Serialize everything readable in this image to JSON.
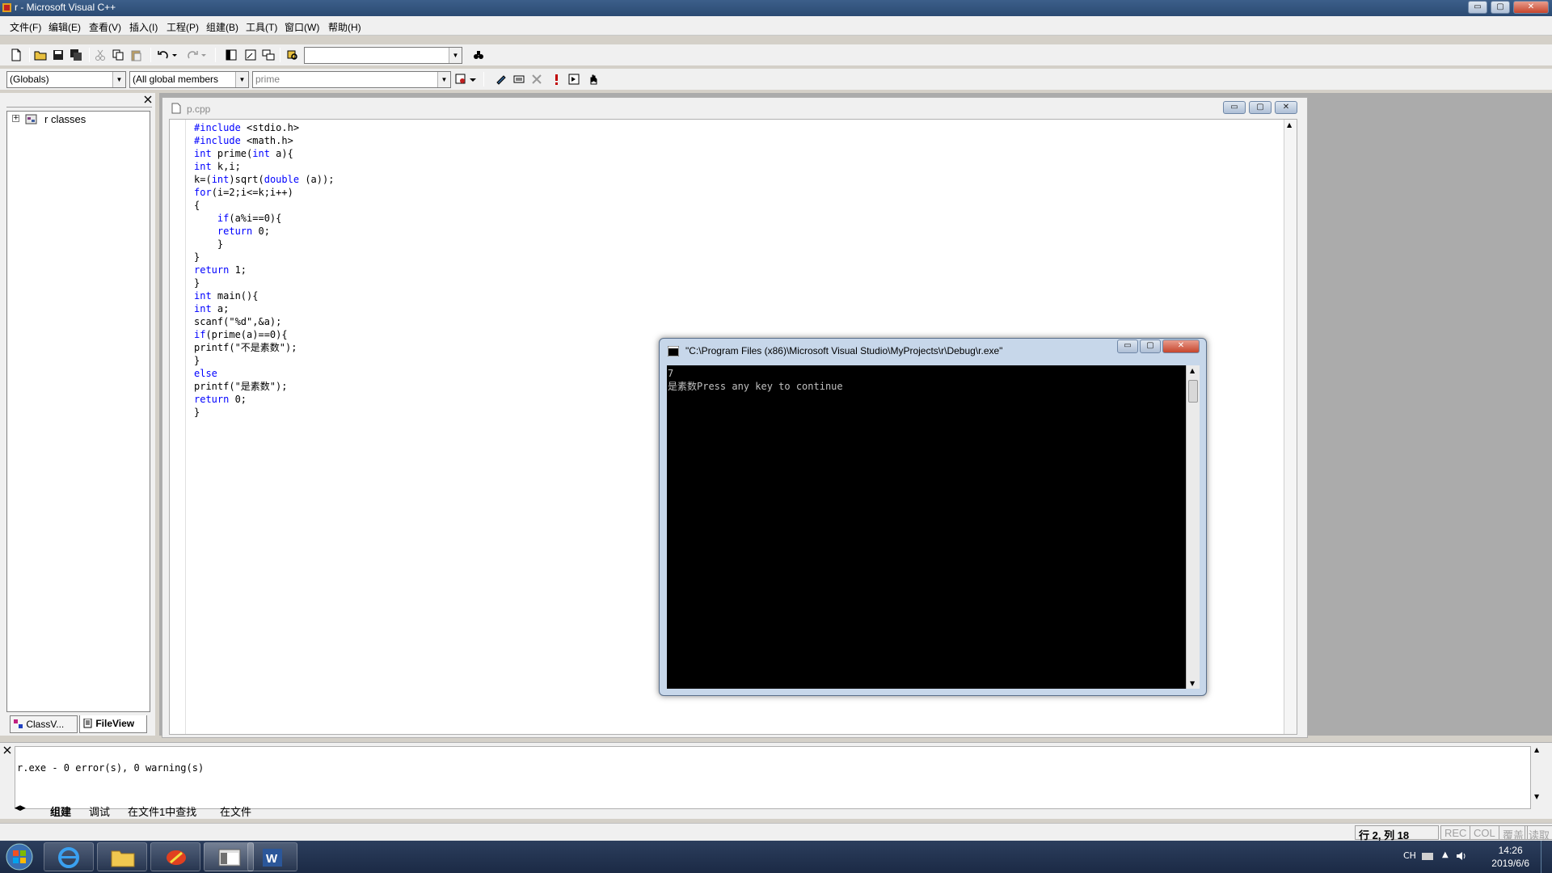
{
  "window": {
    "title": "r - Microsoft Visual C++",
    "minimize_glyph": "▭",
    "maximize_glyph": "▢",
    "close_glyph": "✕"
  },
  "menu": [
    "文件(F)",
    "编辑(E)",
    "查看(V)",
    "插入(I)",
    "工程(P)",
    "组建(B)",
    "工具(T)",
    "窗口(W)",
    "帮助(H)"
  ],
  "toolbar": {
    "find_combo_value": "",
    "globals_combo": "(Globals)",
    "members_combo": "(All global members",
    "function_combo": "prime"
  },
  "workspace": {
    "tree_root": "r classes",
    "expander_glyph": "+",
    "tabs": [
      "ClassV...",
      "FileView"
    ]
  },
  "editor": {
    "filename": "p.cpp",
    "code_lines": [
      [
        {
          "t": "#include",
          "k": 1
        },
        {
          "t": " <stdio.h>"
        }
      ],
      [
        {
          "t": "#include",
          "k": 1
        },
        {
          "t": " <math.h>"
        }
      ],
      [
        {
          "t": "int",
          "k": 1
        },
        {
          "t": " prime("
        },
        {
          "t": "int",
          "k": 1
        },
        {
          "t": " a){"
        }
      ],
      [
        {
          "t": "int",
          "k": 1
        },
        {
          "t": " k,i;"
        }
      ],
      [
        {
          "t": "k=("
        },
        {
          "t": "int",
          "k": 1
        },
        {
          "t": ")sqrt("
        },
        {
          "t": "double",
          "k": 1
        },
        {
          "t": " (a));"
        }
      ],
      [
        {
          "t": "for",
          "k": 1
        },
        {
          "t": "(i=2;i<=k;i++)"
        }
      ],
      [
        {
          "t": "{"
        }
      ],
      [
        {
          "t": "    "
        },
        {
          "t": "if",
          "k": 1
        },
        {
          "t": "(a%i==0){"
        }
      ],
      [
        {
          "t": "    "
        },
        {
          "t": "return",
          "k": 1
        },
        {
          "t": " 0;"
        }
      ],
      [
        {
          "t": "    }"
        }
      ],
      [
        {
          "t": "}"
        }
      ],
      [
        {
          "t": "return",
          "k": 1
        },
        {
          "t": " 1;"
        }
      ],
      [
        {
          "t": "}"
        }
      ],
      [
        {
          "t": "int",
          "k": 1
        },
        {
          "t": " main(){"
        }
      ],
      [
        {
          "t": "int",
          "k": 1
        },
        {
          "t": " a;"
        }
      ],
      [
        {
          "t": "scanf(\"%d\",&a);"
        }
      ],
      [
        {
          "t": "if",
          "k": 1
        },
        {
          "t": "(prime(a)==0){"
        }
      ],
      [
        {
          "t": "printf(\"不是素数\");"
        }
      ],
      [
        {
          "t": "}"
        }
      ],
      [
        {
          "t": "else",
          "k": 1
        }
      ],
      [
        {
          "t": "printf(\"是素数\");"
        }
      ],
      [
        {
          "t": "return",
          "k": 1
        },
        {
          "t": " 0;"
        }
      ],
      [
        {
          "t": "}"
        }
      ]
    ]
  },
  "console": {
    "title": "\"C:\\Program Files (x86)\\Microsoft Visual Studio\\MyProjects\\r\\Debug\\r.exe\"",
    "output": "7\n是素数Press any key to continue"
  },
  "output_pane": {
    "text": "r.exe - 0 error(s), 0 warning(s)",
    "tabs": [
      "组建",
      "调试",
      "在文件1中查找",
      "在文件"
    ]
  },
  "status": {
    "position": "行 2, 列 18",
    "rec": "REC",
    "col": "COL",
    "ovr": "覆盖",
    "read": "读取"
  },
  "taskbar": {
    "lang": "CH",
    "time": "14:26",
    "date": "2019/6/6"
  },
  "colors": {
    "keyword": "#0000ff",
    "console_bg": "#000000",
    "console_fg": "#c0c0c0"
  }
}
